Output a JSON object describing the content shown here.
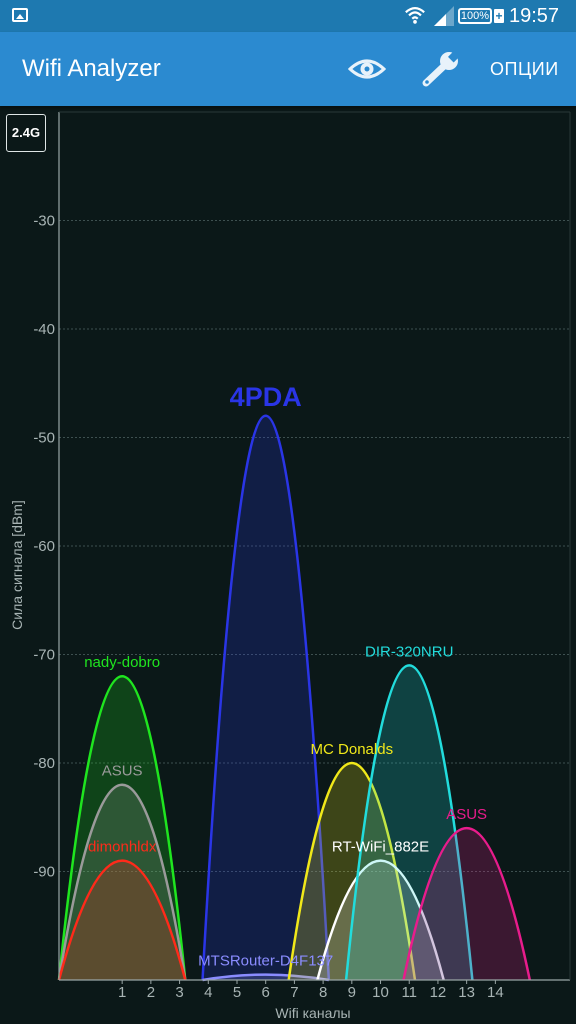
{
  "status_bar": {
    "time": "19:57",
    "battery": "100%",
    "battery_plus": "+"
  },
  "app_bar": {
    "title": "Wifi Analyzer",
    "options_label": "ОПЦИИ"
  },
  "band_label": "2.4G",
  "colors": {
    "status_bar": "#1e79b0",
    "app_bar": "#2b8ad0",
    "chart_bg": "#0b1818"
  },
  "chart_data": {
    "type": "area",
    "ylabel": "Сила сигнала [dBm]",
    "xlabel": "Wifi каналы",
    "y_ticks": [
      -30,
      -40,
      -50,
      -60,
      -70,
      -80,
      -90
    ],
    "ylim": [
      -100,
      -20
    ],
    "x_ticks": [
      1,
      2,
      3,
      4,
      5,
      6,
      7,
      8,
      9,
      10,
      11,
      12,
      13,
      14
    ],
    "xlim": [
      -1.2,
      16.6
    ],
    "grid": true,
    "networks": [
      {
        "ssid": "nady-dobro",
        "channel": 1,
        "level": -72,
        "color": "#1fe51f"
      },
      {
        "ssid": "ASUS",
        "channel": 1,
        "level": -82,
        "color": "#9a9a9a"
      },
      {
        "ssid": "dimonhldx",
        "channel": 1,
        "level": -89,
        "color": "#ff2a1a"
      },
      {
        "ssid": "4PDA",
        "channel": 6,
        "level": -48,
        "color": "#2a35e6"
      },
      {
        "ssid": "MTSRouter-D4F137",
        "channel": 6,
        "level": -99.5,
        "color": "#8a8cff"
      },
      {
        "ssid": "MC Donalds",
        "channel": 9,
        "level": -80,
        "color": "#f0e81a"
      },
      {
        "ssid": "RT-WiFi_882E",
        "channel": 10,
        "level": -89,
        "color": "#ffffff"
      },
      {
        "ssid": "DIR-320NRU",
        "channel": 11,
        "level": -71,
        "color": "#22dcdc"
      },
      {
        "ssid": "ASUS",
        "channel": 13,
        "level": -86,
        "color": "#e81c8c"
      }
    ]
  }
}
